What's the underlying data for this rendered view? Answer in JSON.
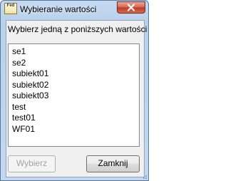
{
  "window": {
    "title": "Wybieranie wartości",
    "icon_text": "Fed",
    "close_icon": "close-icon"
  },
  "dialog": {
    "prompt": "Wybierz jedną z poniższych wartości",
    "items": [
      "se1",
      "se2",
      "subiekt01",
      "subiekt02",
      "subiekt03",
      "test",
      "test01",
      "WF01"
    ],
    "buttons": {
      "select_label": "Wybierz",
      "select_enabled": false,
      "close_label": "Zamknij"
    }
  },
  "colors": {
    "frame": "#c5d9f1",
    "close_button": "#c7432c",
    "client_bg": "#f0f0f0",
    "disabled_text": "#a3a3a3"
  }
}
